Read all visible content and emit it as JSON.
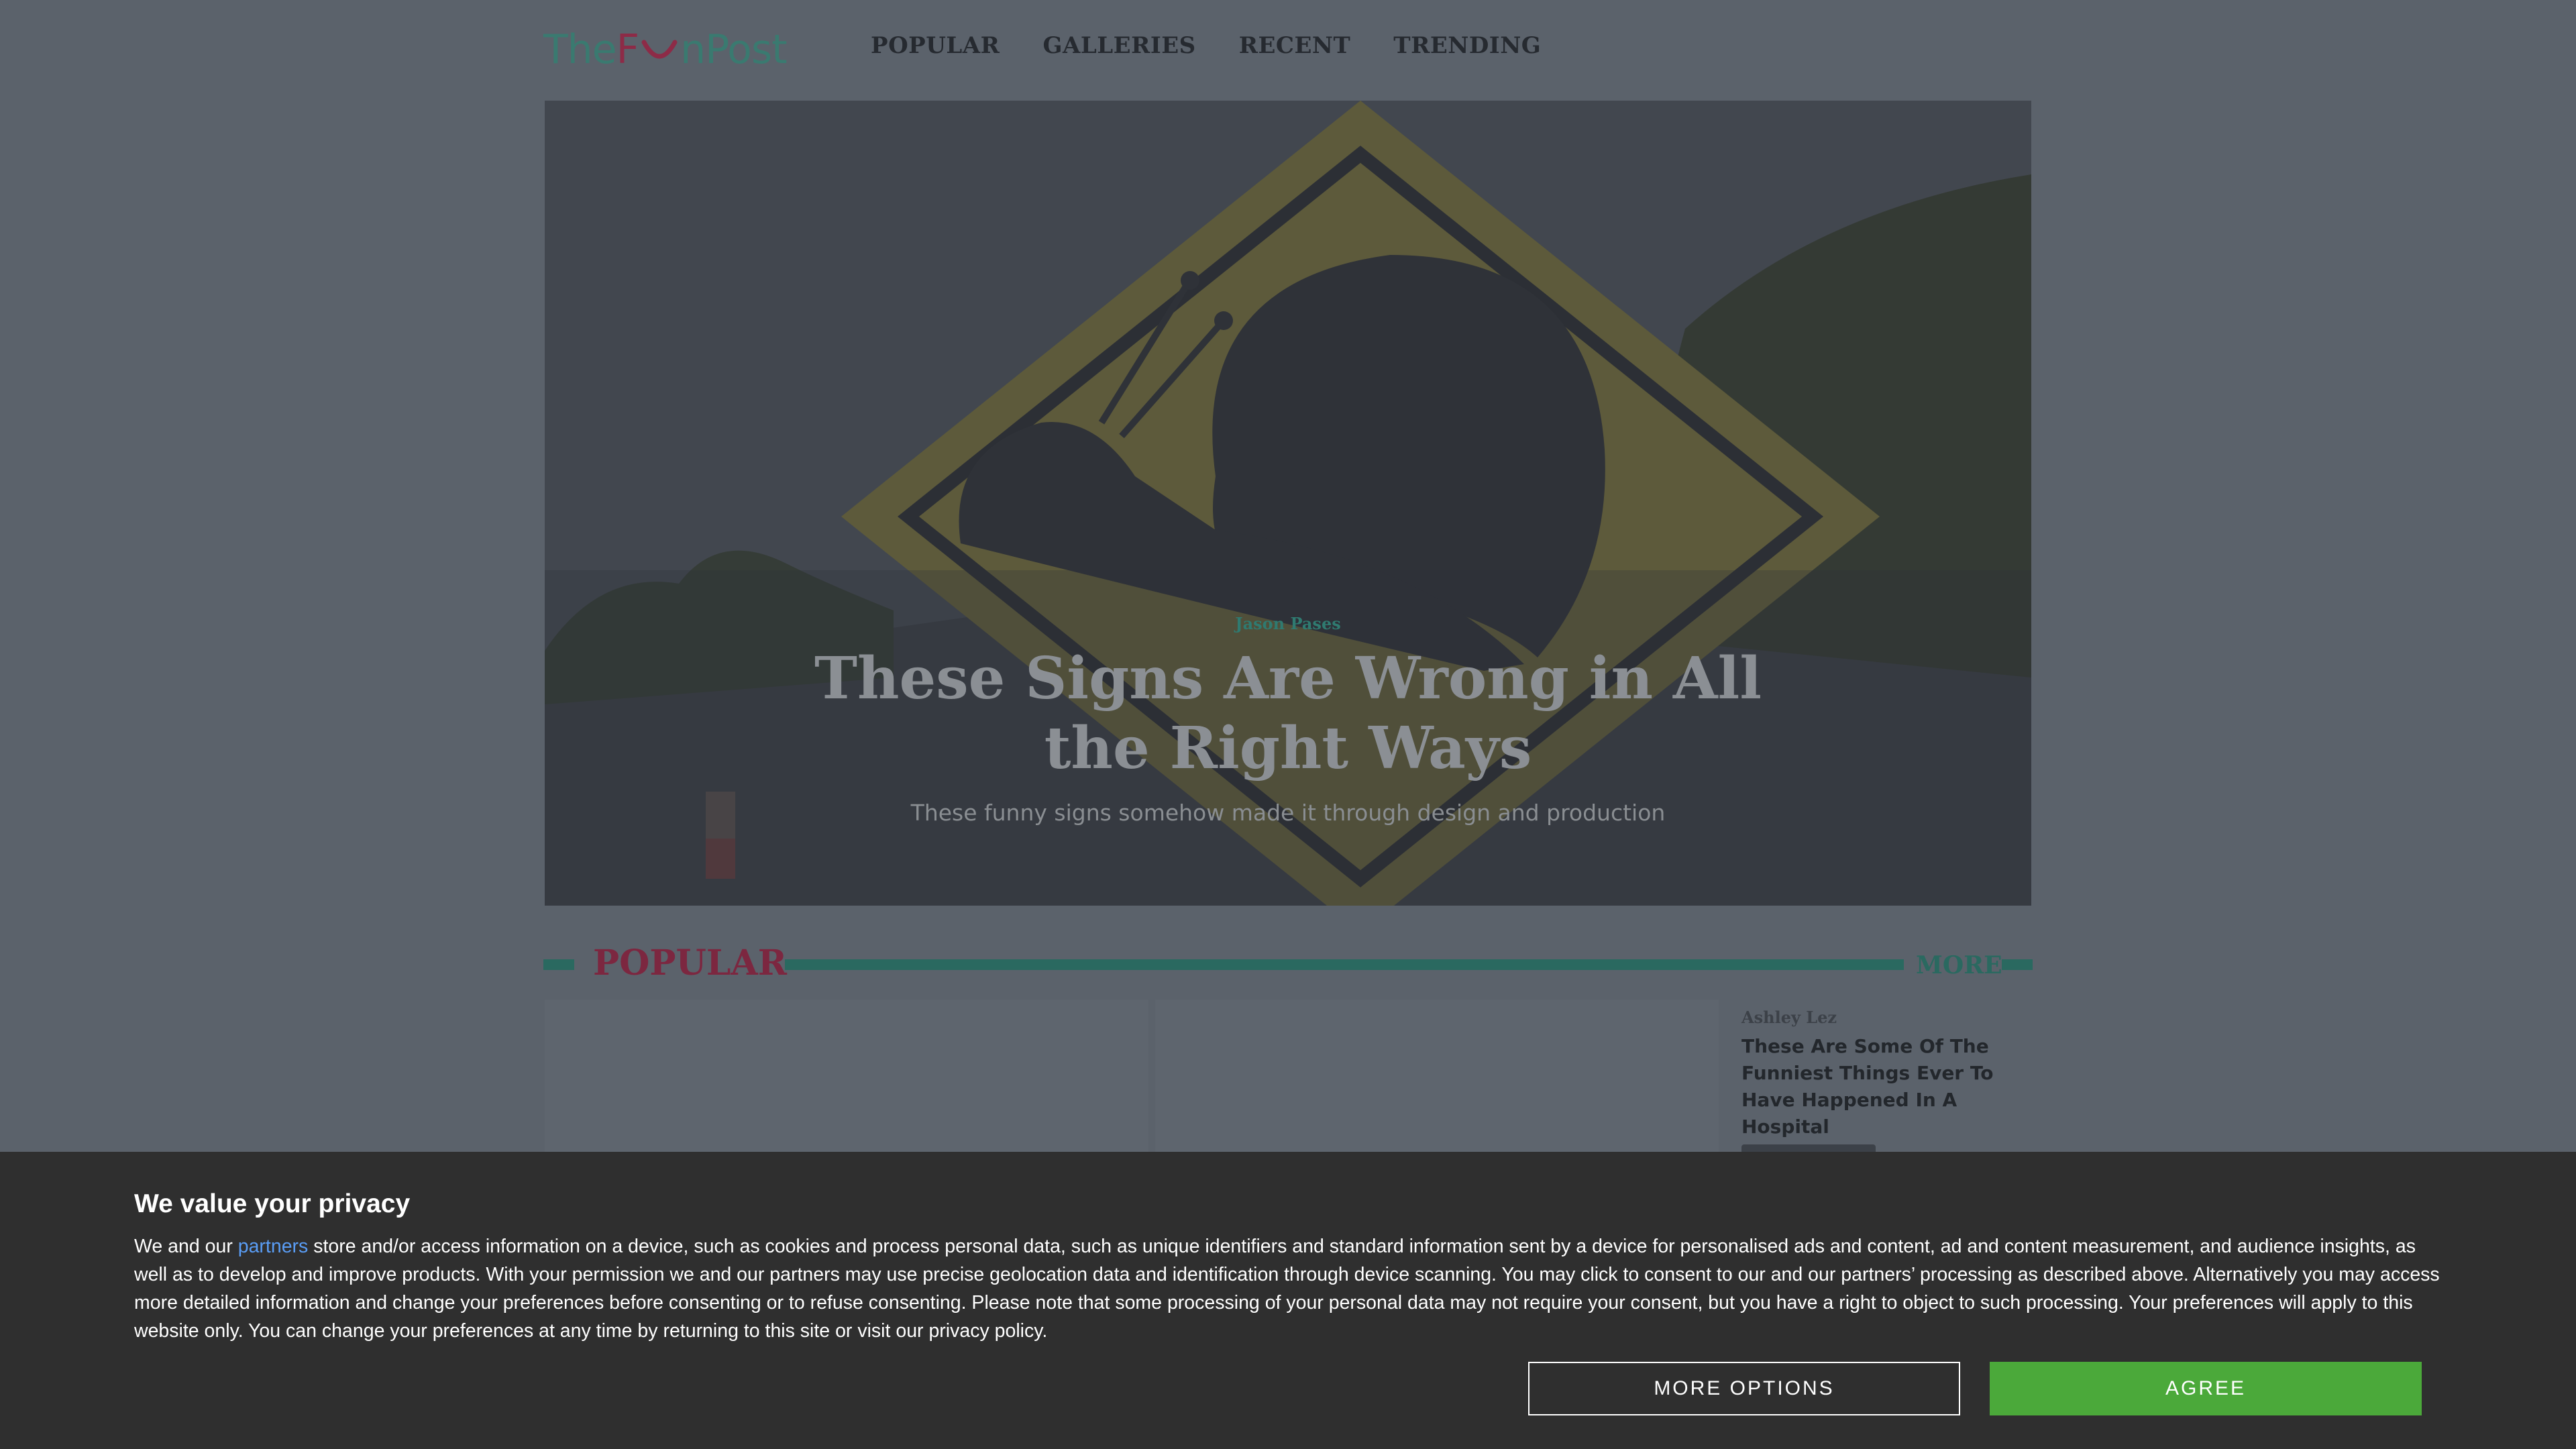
{
  "header": {
    "logo_prefix": "The",
    "logo_f": "F",
    "logo_suffix": "nPost",
    "nav": [
      "POPULAR",
      "GALLERIES",
      "RECENT",
      "TRENDING"
    ]
  },
  "hero": {
    "author": "Jason Pases",
    "title": "These Signs Are Wrong in All the Right Ways",
    "subtitle": "These funny signs somehow made it through design and production"
  },
  "popular": {
    "heading": "POPULAR",
    "more_label": "MORE",
    "side_items": [
      {
        "author": "Ashley Lez",
        "title": "These Are Some Of The Funniest Things Ever To Have Happened In A Hospital"
      }
    ]
  },
  "consent": {
    "heading": "We value your privacy",
    "text_before_link": "We and our ",
    "link_text": "partners",
    "text_after_link": " store and/or access information on a device, such as cookies and process personal data, such as unique identifiers and standard information sent by a device for personalised ads and content, ad and content measurement, and audience insights, as well as to develop and improve products. With your permission we and our partners may use precise geolocation data and identification through device scanning. You may click to consent to our and our partners’ processing as described above. Alternatively you may access more detailed information and change your preferences before consenting or to refuse consenting. Please note that some processing of your personal data may not require your consent, but you have a right to object to such processing. Your preferences will apply to this website only. You can change your preferences at any time by returning to this site or visit our privacy policy.",
    "more_options_label": "MORE OPTIONS",
    "agree_label": "AGREE"
  },
  "colors": {
    "overlay_bg": "#5b626b",
    "brand_teal": "#2a6960",
    "brand_maroon": "#7c2740",
    "consent_bg": "#2f2f2f",
    "agree_green": "#4ba93a",
    "link_blue": "#5a9df5"
  },
  "icons": {
    "hero_image": "snail-crossing-sign-image"
  }
}
